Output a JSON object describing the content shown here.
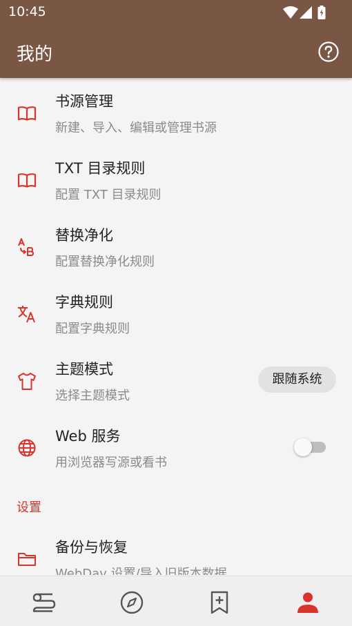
{
  "status_bar": {
    "time": "10:45"
  },
  "app_bar": {
    "title": "我的",
    "help_icon": "help-circle-icon"
  },
  "colors": {
    "app_bar": "#7a5645",
    "accent": "#d9342b",
    "background": "#f4f4f4"
  },
  "items": [
    {
      "title": "书源管理",
      "subtitle": "新建、导入、编辑或管理书源",
      "icon": "book-open-icon"
    },
    {
      "title": "TXT 目录规则",
      "subtitle": "配置 TXT 目录规则",
      "icon": "book-open-icon"
    },
    {
      "title": "替换净化",
      "subtitle": "配置替换净化规则",
      "icon": "find-replace-icon"
    },
    {
      "title": "字典规则",
      "subtitle": "配置字典规则",
      "icon": "translate-icon"
    },
    {
      "title": "主题模式",
      "subtitle": "选择主题模式",
      "icon": "tshirt-icon",
      "value": "跟随系统"
    },
    {
      "title": "Web 服务",
      "subtitle": "用浏览器写源或看书",
      "icon": "globe-icon",
      "toggle_on": false
    }
  ],
  "settings_section": {
    "label": "设置",
    "items": [
      {
        "title": "备份与恢复",
        "subtitle": "WebDav 设置/导入旧版本数据",
        "icon": "folder-icon"
      }
    ]
  },
  "bottom_nav": [
    {
      "name": "bookshelf",
      "icon": "bookshelf-icon",
      "active": false
    },
    {
      "name": "explore",
      "icon": "compass-icon",
      "active": false
    },
    {
      "name": "rss",
      "icon": "bookmark-add-icon",
      "active": false
    },
    {
      "name": "my",
      "icon": "person-icon",
      "active": true
    }
  ]
}
